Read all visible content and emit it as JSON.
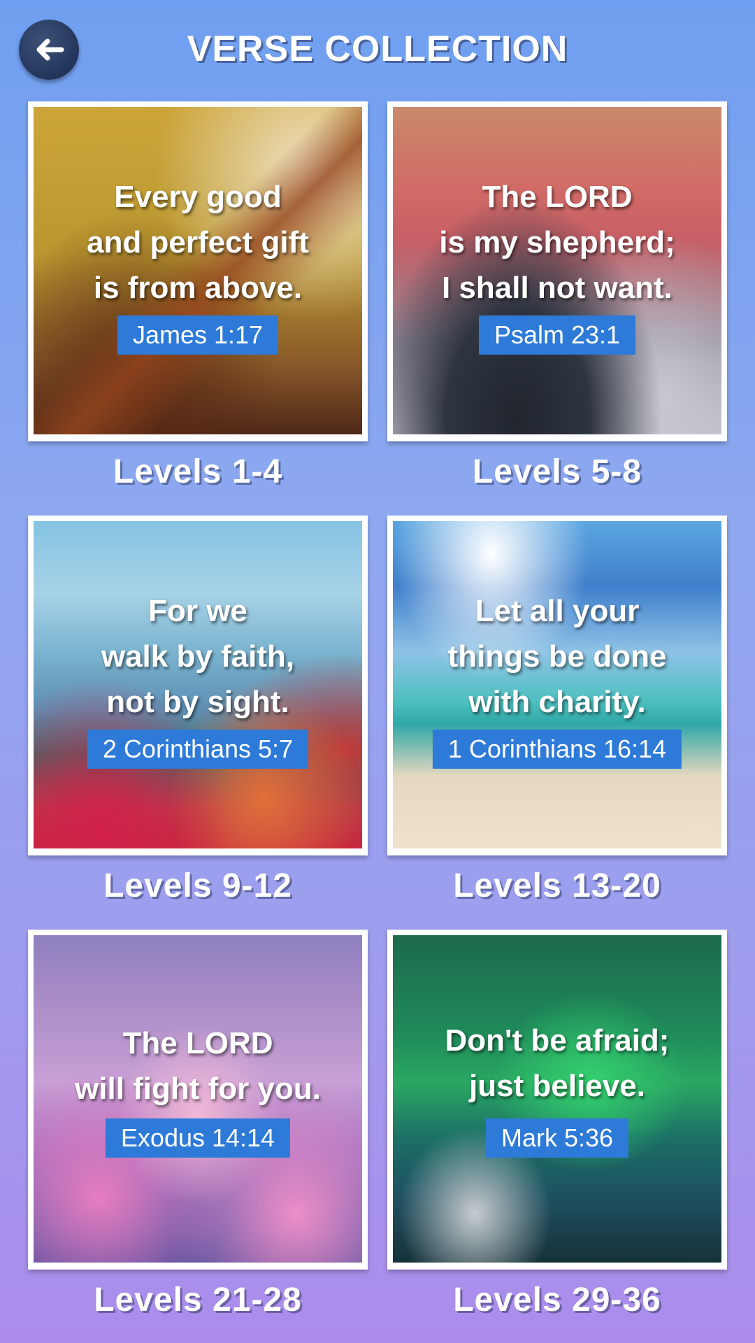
{
  "header": {
    "title": "VERSE COLLECTION",
    "back_icon": "left-arrow-icon"
  },
  "collections": [
    {
      "verse": "Every good\nand perfect gift\nis from above.",
      "reference": "James 1:17",
      "levels": "Levels 1-4"
    },
    {
      "verse": "The LORD\nis my shepherd;\nI shall not want.",
      "reference": "Psalm 23:1",
      "levels": "Levels 5-8"
    },
    {
      "verse": "For we\nwalk by faith,\nnot by sight.",
      "reference": "2 Corinthians 5:7",
      "levels": "Levels 9-12"
    },
    {
      "verse": "Let all your\nthings be done\nwith charity.",
      "reference": "1 Corinthians 16:14",
      "levels": "Levels 13-20"
    },
    {
      "verse": "The LORD\nwill fight for you.",
      "reference": "Exodus 14:14",
      "levels": "Levels 21-28"
    },
    {
      "verse": "Don't be afraid;\njust believe.",
      "reference": "Mark 5:36",
      "levels": "Levels 29-36"
    }
  ],
  "colors": {
    "reference_badge": "#2e7ad8",
    "back_button": "#23355a"
  }
}
